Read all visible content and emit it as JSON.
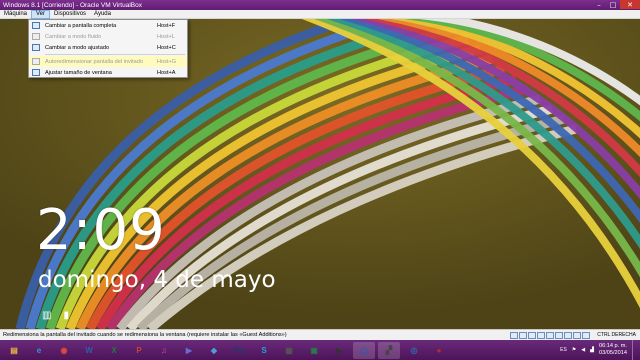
{
  "window": {
    "title": "Windows 8.1 [Corriendo] - Oracle VM VirtualBox",
    "buttons": {
      "minimize": "–",
      "maximize": "□",
      "close": "✕"
    }
  },
  "menu": [
    {
      "label": "Máquina"
    },
    {
      "label": "Ver",
      "active": true
    },
    {
      "label": "Dispositivos"
    },
    {
      "label": "Ayuda"
    }
  ],
  "dropdown": {
    "items": [
      {
        "label": "Cambiar a pantalla completa",
        "shortcut": "Host+F",
        "icon": "fullscreen-icon",
        "disabled": false
      },
      {
        "label": "Cambiar a modo fluido",
        "shortcut": "Host+L",
        "icon": "seamless-icon",
        "disabled": true
      },
      {
        "label": "Cambiar a modo ajustado",
        "shortcut": "Host+C",
        "icon": "scale-icon",
        "disabled": false
      },
      {
        "label": "Autoredimensionar pantalla del invitado",
        "shortcut": "Host+G",
        "icon": "auto-resize-icon",
        "disabled": true,
        "hover": true
      },
      {
        "label": "Ajustar tamaño de ventana",
        "shortcut": "Host+A",
        "icon": "adjust-window-icon",
        "disabled": false
      }
    ]
  },
  "lockscreen": {
    "time": "2:09",
    "date": "domingo, 4 de mayo",
    "icons": [
      "network-icon",
      "battery-icon"
    ]
  },
  "statusbar": {
    "text": "Redimensiona la pantalla del invitado cuando se redimensiona la ventana (requiere instalar las «Guest Additions»)",
    "hostkey": "CTRL DERECHA",
    "icons": [
      "hdd-icon",
      "optical-icon",
      "usb-icon",
      "shared-folder-icon",
      "network-icon",
      "display-icon",
      "video-capture-icon",
      "cpu-icon",
      "mouse-icon"
    ]
  },
  "taskbar": {
    "apps": [
      {
        "name": "explorer-icon",
        "glyph": "▤",
        "color": "#e8b84a"
      },
      {
        "name": "ie-icon",
        "glyph": "e",
        "color": "#3b8ee0"
      },
      {
        "name": "chrome-icon",
        "glyph": "◉",
        "color": "#e04a3b"
      },
      {
        "name": "word-icon",
        "glyph": "W",
        "color": "#2b5fad"
      },
      {
        "name": "excel-icon",
        "glyph": "X",
        "color": "#1f7a3c"
      },
      {
        "name": "powerpoint-icon",
        "glyph": "P",
        "color": "#c9452b"
      },
      {
        "name": "itunes-icon",
        "glyph": "♫",
        "color": "#d34a9e"
      },
      {
        "name": "media-icon",
        "glyph": "▶",
        "color": "#6b6bd6"
      },
      {
        "name": "app-icon",
        "glyph": "◆",
        "color": "#4a9fd9"
      },
      {
        "name": "photoshop-icon",
        "glyph": "Ps",
        "color": "#1e3a6e"
      },
      {
        "name": "skype-icon",
        "glyph": "S",
        "color": "#1ea3e0"
      },
      {
        "name": "calculator-icon",
        "glyph": "▦",
        "color": "#555"
      },
      {
        "name": "store-icon",
        "glyph": "▣",
        "color": "#2a7a4a"
      },
      {
        "name": "media-player-icon",
        "glyph": "▶",
        "color": "#333"
      },
      {
        "name": "virtualbox-icon",
        "glyph": "▢",
        "color": "#1c5fb0",
        "running": true
      },
      {
        "name": "movie-icon",
        "glyph": "▞",
        "color": "#444",
        "running": true
      },
      {
        "name": "camera-icon",
        "glyph": "◎",
        "color": "#2e6cb0"
      },
      {
        "name": "app2-icon",
        "glyph": "●",
        "color": "#b52a2a"
      }
    ],
    "tray": {
      "lang": "ES",
      "time": "06:14 p. m.",
      "date": "03/05/2014"
    }
  }
}
